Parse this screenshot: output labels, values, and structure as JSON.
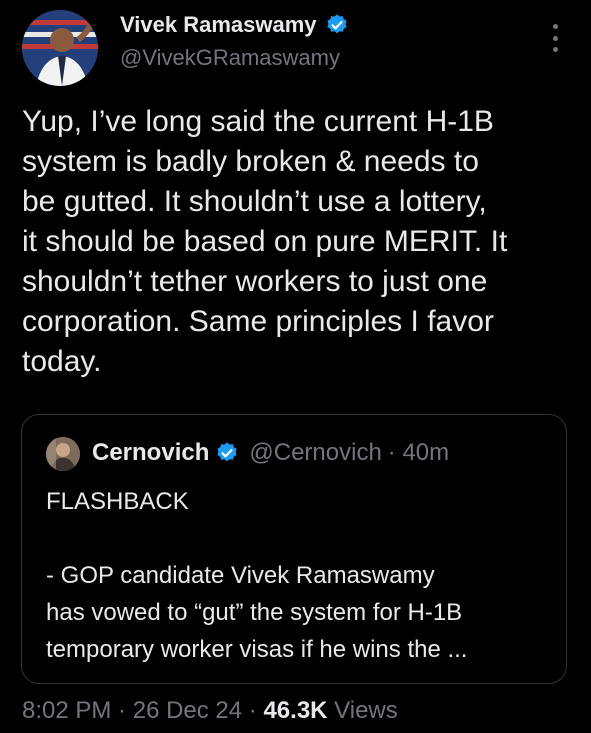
{
  "author": {
    "name": "Vivek Ramaswamy",
    "handle": "@VivekGRamaswamy",
    "verified_color": "#1d9bf0",
    "avatar_icon": "profile-photo"
  },
  "tweet": {
    "lines": [
      "Yup, I’ve long said the current H-1B",
      "system is badly broken & needs to",
      "be gutted. It shouldn’t use a lottery,",
      "it should be based on pure MERIT. It",
      "shouldn’t tether workers to just one",
      "corporation. Same principles I favor",
      "today."
    ]
  },
  "quote": {
    "name": "Cernovich",
    "handle": "@Cernovich",
    "time": "· 40m",
    "lines": [
      "FLASHBACK",
      "",
      "- GOP candidate Vivek Ramaswamy",
      "has vowed to “gut” the system for H-1B",
      "temporary worker visas if he wins the ..."
    ]
  },
  "meta": {
    "time": "8:02 PM",
    "sep1": " · ",
    "date": "26 Dec 24",
    "sep2": " · ",
    "views_count": "46.3K",
    "views_label": " Views"
  }
}
